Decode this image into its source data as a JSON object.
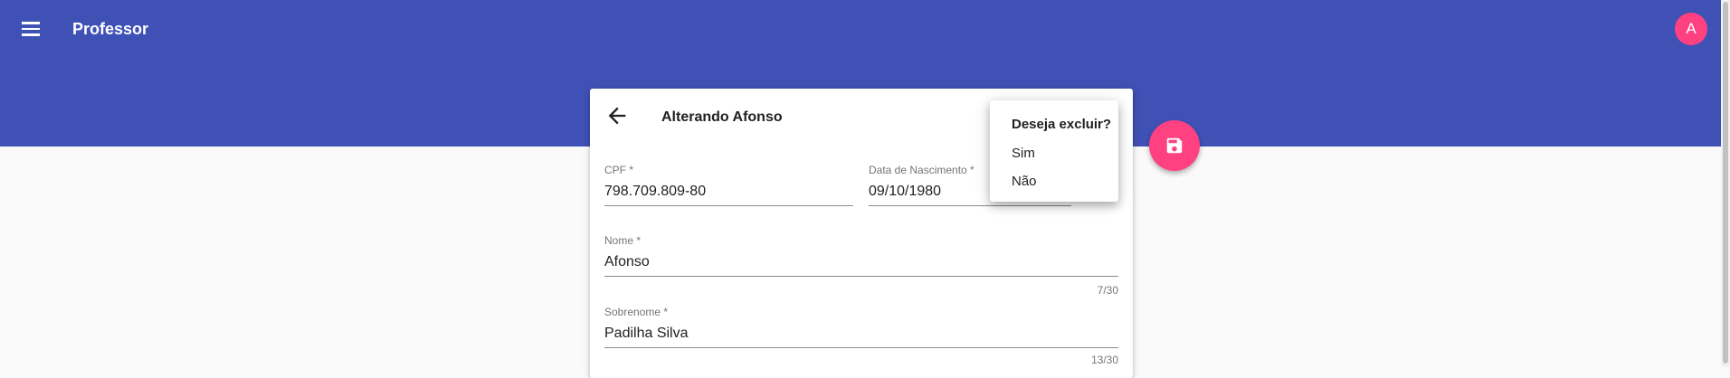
{
  "toolbar": {
    "title": "Professor",
    "menu_icon": "menu-icon",
    "avatar_letter": "A"
  },
  "colors": {
    "primary": "#3f51b5",
    "accent": "#ff4081"
  },
  "form": {
    "title": "Alterando Afonso",
    "back_icon": "arrow-back-icon",
    "cpf": {
      "label": "CPF *",
      "value": "798.709.809-80"
    },
    "birthdate": {
      "label": "Data de Nascimento *",
      "value": "09/10/1980",
      "icon": "calendar-icon"
    },
    "nome": {
      "label": "Nome *",
      "value": "Afonso",
      "counter": "7/30"
    },
    "sobrenome": {
      "label": "Sobrenome *",
      "value": "Padilha Silva",
      "counter": "13/30"
    }
  },
  "delete_menu": {
    "question": "Deseja excluir?",
    "yes": "Sim",
    "no": "Não"
  },
  "fab": {
    "icon": "save-icon"
  }
}
